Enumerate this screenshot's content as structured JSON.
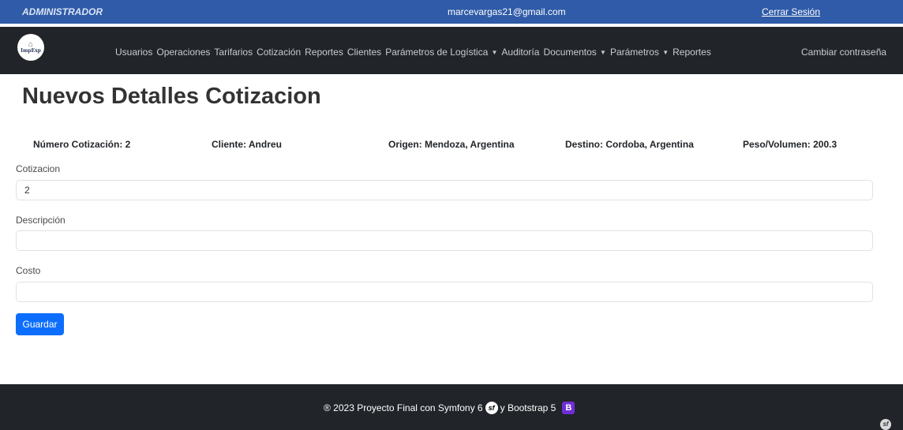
{
  "topbar": {
    "role": "ADMINISTRADOR",
    "email": "marcevargas21@gmail.com",
    "logout": "Cerrar Sesión"
  },
  "navbar": {
    "logo_text": "ImpExp",
    "items": [
      {
        "label": "Usuarios",
        "dropdown": false
      },
      {
        "label": "Operaciones",
        "dropdown": false
      },
      {
        "label": "Tarifarios",
        "dropdown": false
      },
      {
        "label": "Cotización",
        "dropdown": false
      },
      {
        "label": "Reportes",
        "dropdown": false
      },
      {
        "label": "Clientes",
        "dropdown": false
      },
      {
        "label": "Parámetros de Logística",
        "dropdown": true
      },
      {
        "label": "Auditoría",
        "dropdown": false
      },
      {
        "label": "Documentos",
        "dropdown": true
      },
      {
        "label": "Parámetros",
        "dropdown": true
      },
      {
        "label": "Reportes",
        "dropdown": false
      }
    ],
    "right_link": "Cambiar contraseña"
  },
  "page": {
    "title": "Nuevos Detalles Cotizacion"
  },
  "summary": {
    "numero": "Número Cotización: 2",
    "cliente": "Cliente: Andreu",
    "origen": "Origen: Mendoza, Argentina",
    "destino": "Destino: Cordoba, Argentina",
    "peso": "Peso/Volumen: 200.3"
  },
  "form": {
    "cotizacion_label": "Cotizacion",
    "cotizacion_value": "2",
    "descripcion_label": "Descripción",
    "descripcion_value": "",
    "costo_label": "Costo",
    "costo_value": "",
    "save_label": "Guardar"
  },
  "footer": {
    "text_before": "® 2023 Proyecto Final con Symfony 6",
    "text_after": "y Bootstrap 5",
    "sf_glyph": "sf",
    "bs_glyph": "B"
  }
}
